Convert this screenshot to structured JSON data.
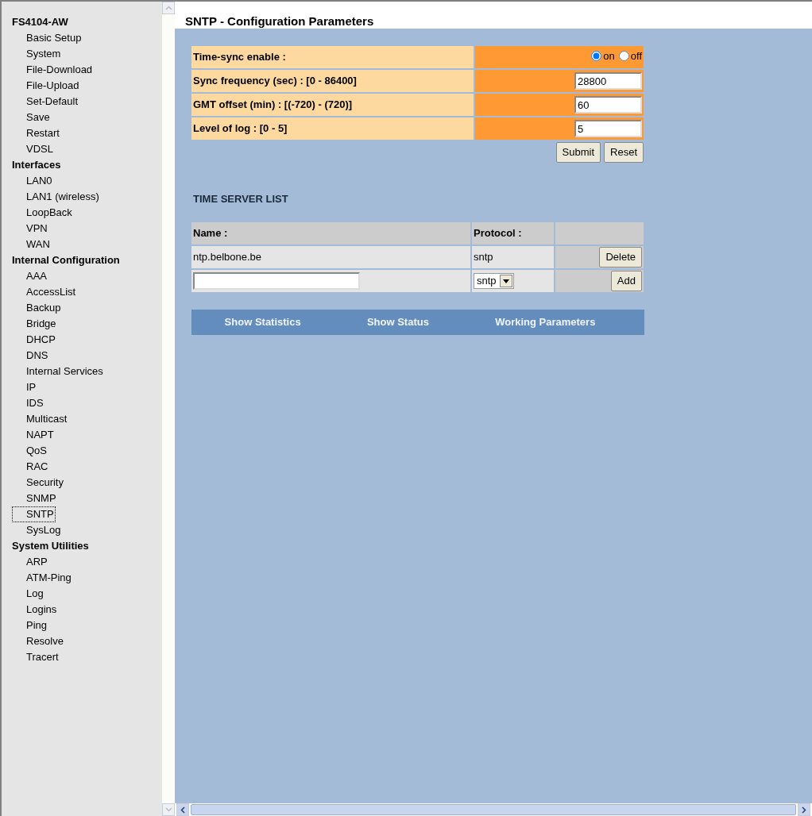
{
  "sidebar": {
    "groups": [
      {
        "title": "FS4104-AW",
        "items": [
          {
            "label": "Basic Setup",
            "selected": false
          },
          {
            "label": "System",
            "selected": false
          },
          {
            "label": "File-Download",
            "selected": false
          },
          {
            "label": "File-Upload",
            "selected": false
          },
          {
            "label": "Set-Default",
            "selected": false
          },
          {
            "label": "Save",
            "selected": false
          },
          {
            "label": "Restart",
            "selected": false
          },
          {
            "label": "VDSL",
            "selected": false
          }
        ]
      },
      {
        "title": "Interfaces",
        "items": [
          {
            "label": "LAN0",
            "selected": false
          },
          {
            "label": "LAN1 (wireless)",
            "selected": false
          },
          {
            "label": "LoopBack",
            "selected": false
          },
          {
            "label": "VPN",
            "selected": false
          },
          {
            "label": "WAN",
            "selected": false
          }
        ]
      },
      {
        "title": "Internal Configuration",
        "items": [
          {
            "label": "AAA",
            "selected": false
          },
          {
            "label": "AccessList",
            "selected": false
          },
          {
            "label": "Backup",
            "selected": false
          },
          {
            "label": "Bridge",
            "selected": false
          },
          {
            "label": "DHCP",
            "selected": false
          },
          {
            "label": "DNS",
            "selected": false
          },
          {
            "label": "Internal Services",
            "selected": false
          },
          {
            "label": "IP",
            "selected": false
          },
          {
            "label": "IDS",
            "selected": false
          },
          {
            "label": "Multicast",
            "selected": false
          },
          {
            "label": "NAPT",
            "selected": false
          },
          {
            "label": "QoS",
            "selected": false
          },
          {
            "label": "RAC",
            "selected": false
          },
          {
            "label": "Security",
            "selected": false
          },
          {
            "label": "SNMP",
            "selected": false
          },
          {
            "label": "SNTP",
            "selected": true
          },
          {
            "label": "SysLog",
            "selected": false
          }
        ]
      },
      {
        "title": "System Utilities",
        "items": [
          {
            "label": "ARP",
            "selected": false
          },
          {
            "label": "ATM-Ping",
            "selected": false
          },
          {
            "label": "Log",
            "selected": false
          },
          {
            "label": "Logins",
            "selected": false
          },
          {
            "label": "Ping",
            "selected": false
          },
          {
            "label": "Resolve",
            "selected": false
          },
          {
            "label": "Tracert",
            "selected": false
          }
        ]
      }
    ]
  },
  "page_title": "SNTP - Configuration Parameters",
  "config": {
    "rows": [
      {
        "kind": "radio",
        "label": "Time-sync enable :",
        "options": [
          {
            "label": "on",
            "selected": true
          },
          {
            "label": "off",
            "selected": false
          }
        ]
      },
      {
        "kind": "text",
        "label": "Sync frequency (sec) : [0 - 86400]",
        "value": "28800"
      },
      {
        "kind": "text",
        "label": "GMT offset (min) : [(-720) - (720)]",
        "value": "60"
      },
      {
        "kind": "text",
        "label": "Level of log : [0 - 5]",
        "value": "5"
      }
    ],
    "buttons": [
      "Submit",
      "Reset"
    ]
  },
  "server_list": {
    "title": "TIME SERVER LIST",
    "columns": [
      "Name :",
      "Protocol :"
    ],
    "rows": [
      {
        "name": "ntp.belbone.be",
        "protocol": "sntp",
        "action": "Delete"
      }
    ],
    "new_row": {
      "protocol": "sntp",
      "action": "Add"
    }
  },
  "links": [
    "Show Statistics",
    "Show Status",
    "Working Parameters"
  ]
}
